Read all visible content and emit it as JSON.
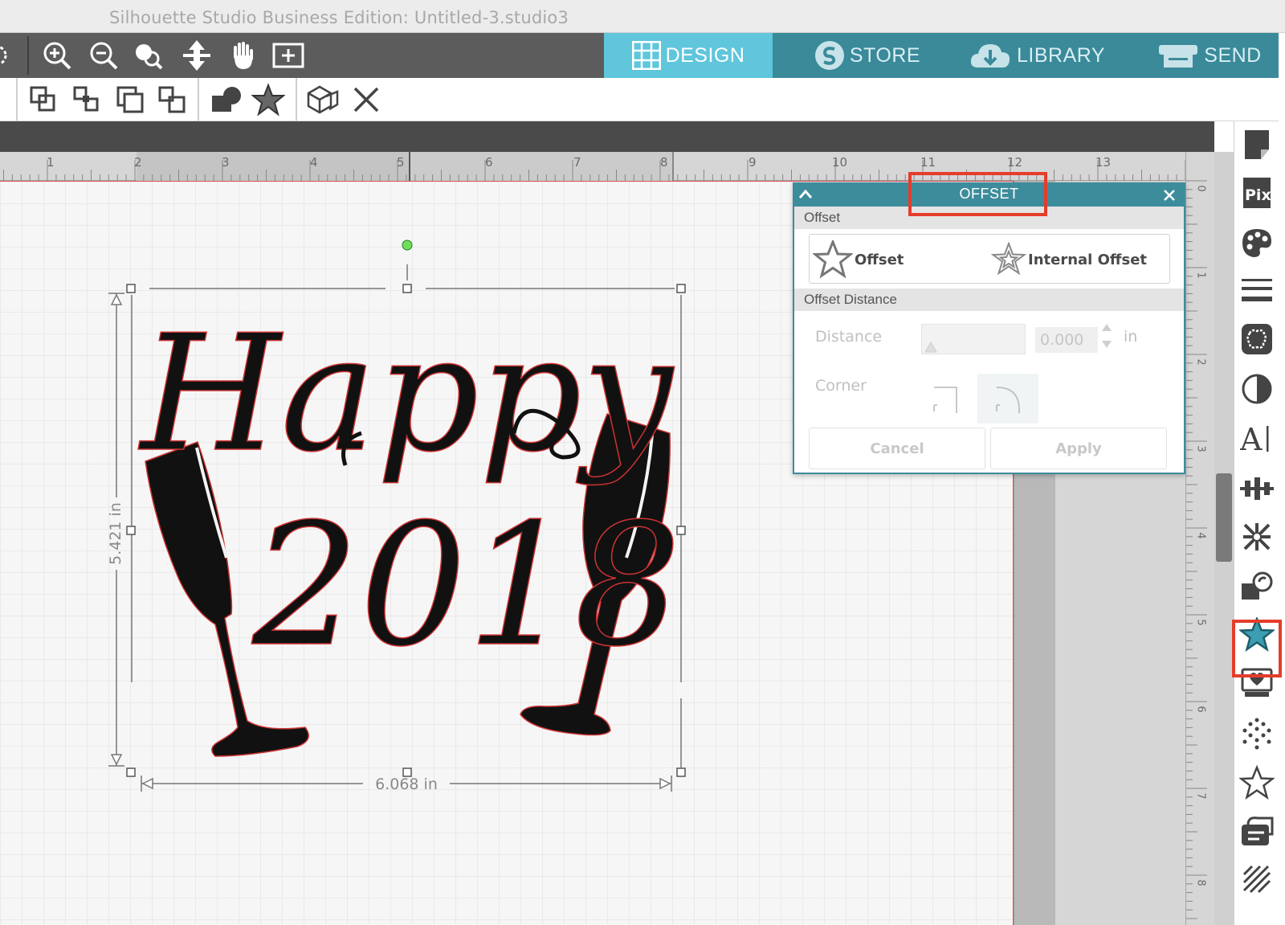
{
  "window": {
    "title": "Silhouette Studio Business Edition: Untitled-3.studio3"
  },
  "nav": {
    "tabs": [
      {
        "label": "DESIGN",
        "active": true
      },
      {
        "label": "STORE",
        "active": false
      },
      {
        "label": "LIBRARY",
        "active": false
      },
      {
        "label": "SEND",
        "active": false
      }
    ]
  },
  "ruler": {
    "top_numbers": [
      "1",
      "2",
      "3",
      "4",
      "5",
      "6",
      "7",
      "8",
      "9",
      "10",
      "11",
      "12",
      "13"
    ],
    "right_numbers": [
      "0",
      "1",
      "2",
      "3",
      "4",
      "5",
      "6",
      "7",
      "8"
    ]
  },
  "design": {
    "text_line1": "Happy",
    "text_line2": "2018",
    "height_label": "5.421 in",
    "width_label": "6.068 in"
  },
  "offset_panel": {
    "title": "OFFSET",
    "section_offset": "Offset",
    "option_offset": "Offset",
    "option_internal": "Internal Offset",
    "section_distance": "Offset Distance",
    "distance_label": "Distance",
    "distance_value": "0.000",
    "distance_unit": "in",
    "corner_label": "Corner",
    "cancel_label": "Cancel",
    "apply_label": "Apply"
  },
  "colors": {
    "accent_teal": "#3d8c9b",
    "design_tab": "#5fc6dc",
    "highlight_red": "#e53d2b",
    "toolbar_dark": "#5c5c5c"
  },
  "right_panel_icons": [
    "page-setup-icon",
    "pixscan-icon",
    "fill-color-icon",
    "line-style-icon",
    "trace-icon",
    "image-effects-icon",
    "text-style-icon",
    "align-icon",
    "replicate-icon",
    "modify-icon",
    "offset-star-icon",
    "design-store-icon",
    "rhinestone-icon",
    "sketch-icon",
    "transform-icon",
    "fill-pattern-icon"
  ]
}
